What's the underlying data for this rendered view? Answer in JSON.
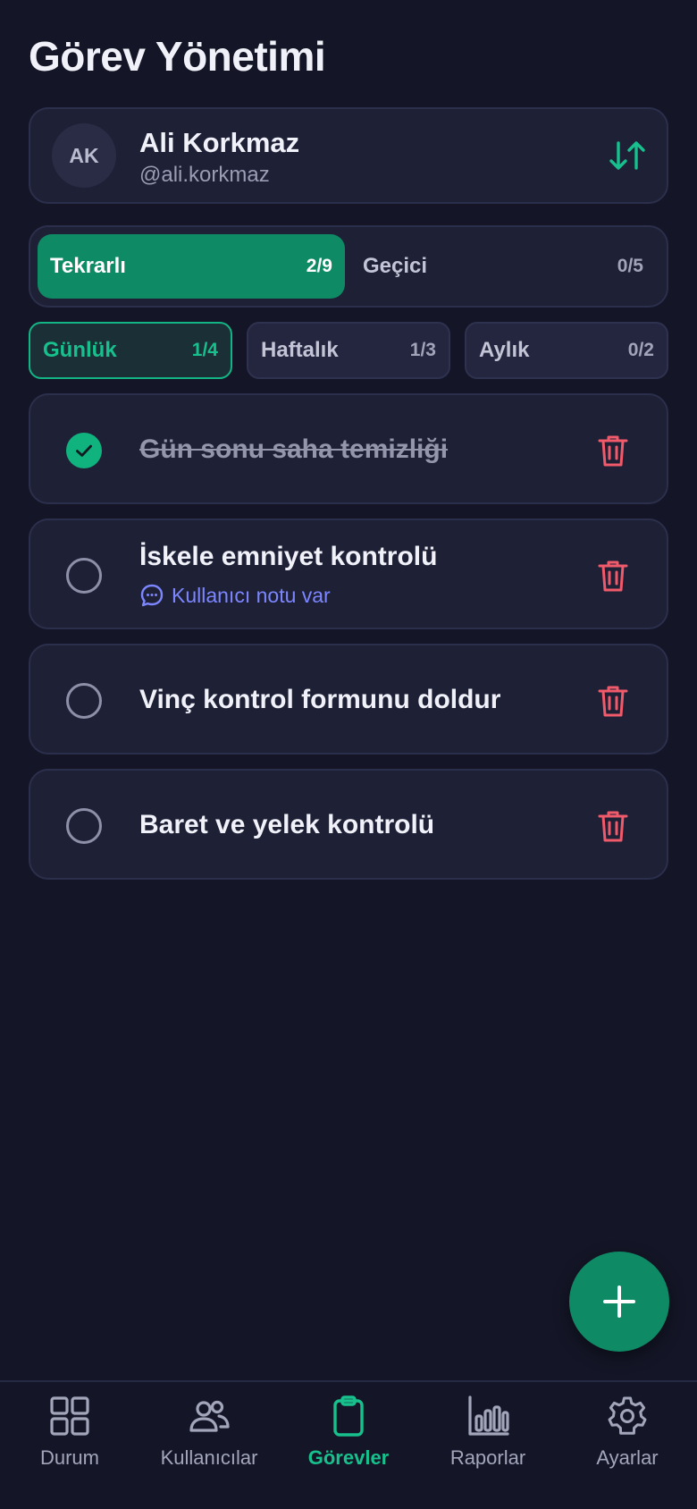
{
  "header": {
    "title": "Görev Yönetimi"
  },
  "user": {
    "initials": "AK",
    "name": "Ali Korkmaz",
    "handle": "@ali.korkmaz",
    "sort_icon": "sort-arrows-icon"
  },
  "segments": [
    {
      "label": "Tekrarlı",
      "count": "2/9",
      "active": true
    },
    {
      "label": "Geçici",
      "count": "0/5",
      "active": false
    }
  ],
  "periods": [
    {
      "label": "Günlük",
      "count": "1/4",
      "active": true
    },
    {
      "label": "Haftalık",
      "count": "1/3",
      "active": false
    },
    {
      "label": "Aylık",
      "count": "0/2",
      "active": false
    }
  ],
  "tasks": [
    {
      "title": "Gün sonu saha temizliği",
      "done": true,
      "note": ""
    },
    {
      "title": "İskele emniyet kontrolü",
      "done": false,
      "note": "Kullanıcı notu var"
    },
    {
      "title": "Vinç kontrol formunu doldur",
      "done": false,
      "note": ""
    },
    {
      "title": "Baret ve yelek kontrolü",
      "done": false,
      "note": ""
    }
  ],
  "fab": {
    "icon": "plus-icon"
  },
  "nav": [
    {
      "label": "Durum",
      "icon": "grid-icon",
      "active": false
    },
    {
      "label": "Kullanıcılar",
      "icon": "users-icon",
      "active": false
    },
    {
      "label": "Görevler",
      "icon": "clipboard-icon",
      "active": true
    },
    {
      "label": "Raporlar",
      "icon": "bar-chart-icon",
      "active": false
    },
    {
      "label": "Ayarlar",
      "icon": "gear-icon",
      "active": false
    }
  ],
  "colors": {
    "background": "#141627",
    "card": "#1e2036",
    "accent": "#0e8a64",
    "accent_text": "#17c08c",
    "danger": "#f05a6a",
    "link": "#7c86ff"
  }
}
